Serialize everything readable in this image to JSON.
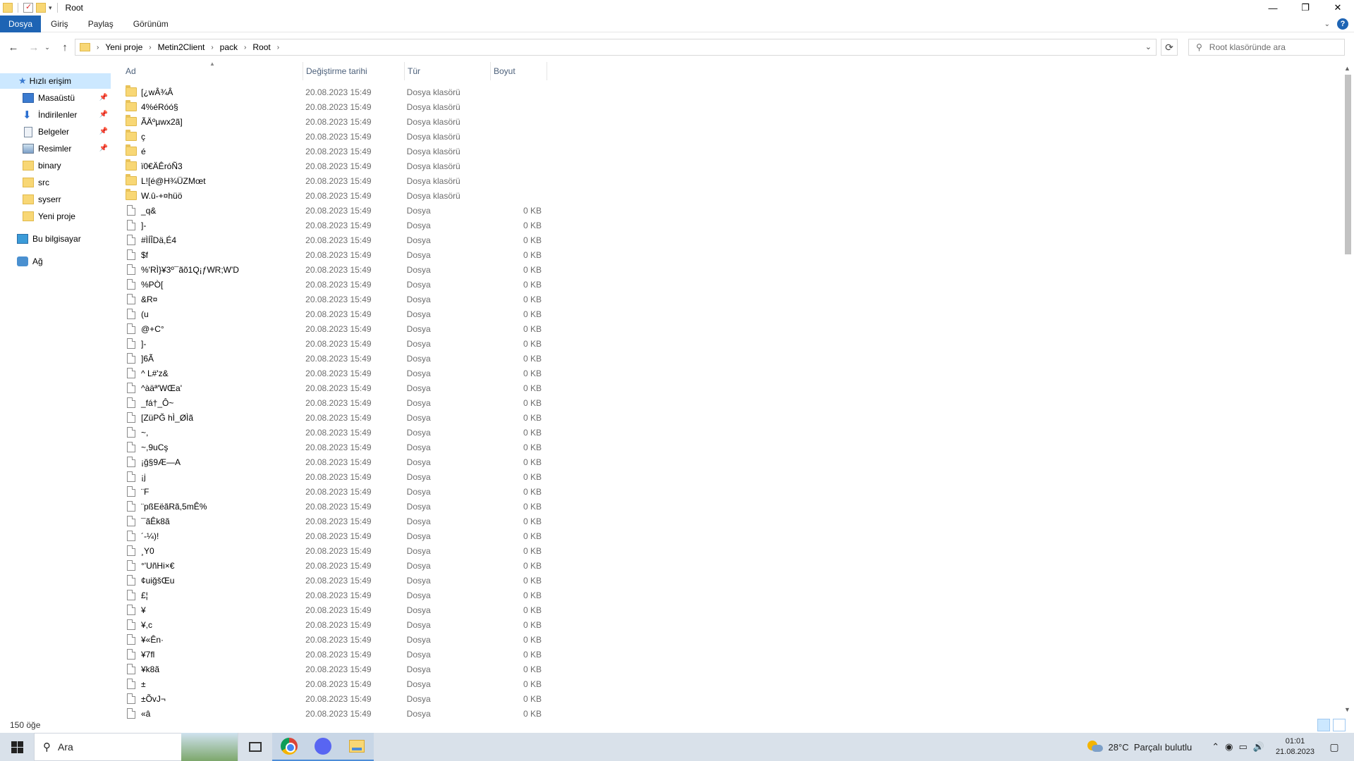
{
  "window": {
    "title": "Root"
  },
  "ribbon": {
    "tabs": [
      "Dosya",
      "Giriş",
      "Paylaş",
      "Görünüm"
    ]
  },
  "address": {
    "crumbs": [
      "Yeni proje",
      "Metin2Client",
      "pack",
      "Root"
    ],
    "search_placeholder": "Root klasöründe ara"
  },
  "sidebar": {
    "items": [
      {
        "label": "Hızlı erişim",
        "icon": "star-icon"
      },
      {
        "label": "Masaüstü",
        "icon": "desktop-icon"
      },
      {
        "label": "İndirilenler",
        "icon": "download-icon"
      },
      {
        "label": "Belgeler",
        "icon": "documents-icon"
      },
      {
        "label": "Resimler",
        "icon": "pictures-icon"
      },
      {
        "label": "binary",
        "icon": "folder-icon"
      },
      {
        "label": "src",
        "icon": "folder-icon"
      },
      {
        "label": "syserr",
        "icon": "folder-icon"
      },
      {
        "label": "Yeni proje",
        "icon": "folder-icon"
      },
      {
        "label": "Bu bilgisayar",
        "icon": "computer-icon"
      },
      {
        "label": "Ağ",
        "icon": "network-icon"
      }
    ]
  },
  "columns": {
    "name": "Ad",
    "date": "Değiştirme tarihi",
    "type": "Tür",
    "size": "Boyut"
  },
  "files": [
    {
      "name": "[¿wÂ¾Â",
      "date": "20.08.2023 15:49",
      "type": "Dosya klasörü",
      "size": "",
      "folder": true
    },
    {
      "name": "4%éRóó§",
      "date": "20.08.2023 15:49",
      "type": "Dosya klasörü",
      "size": "",
      "folder": true
    },
    {
      "name": "ÃÄºµwx2ã]",
      "date": "20.08.2023 15:49",
      "type": "Dosya klasörü",
      "size": "",
      "folder": true
    },
    {
      "name": "ç",
      "date": "20.08.2023 15:49",
      "type": "Dosya klasörü",
      "size": "",
      "folder": true
    },
    {
      "name": "é",
      "date": "20.08.2023 15:49",
      "type": "Dosya klasörü",
      "size": "",
      "folder": true
    },
    {
      "name": "ï0€ÄÊróÑ3",
      "date": "20.08.2023 15:49",
      "type": "Dosya klasörü",
      "size": "",
      "folder": true
    },
    {
      "name": "L![é@H¾ÜZMœt",
      "date": "20.08.2023 15:49",
      "type": "Dosya klasörü",
      "size": "",
      "folder": true
    },
    {
      "name": "W.û-+¤hüö",
      "date": "20.08.2023 15:49",
      "type": "Dosya klasörü",
      "size": "",
      "folder": true
    },
    {
      "name": "_q&",
      "date": "20.08.2023 15:49",
      "type": "Dosya",
      "size": "0 KB",
      "folder": false
    },
    {
      "name": "]-",
      "date": "20.08.2023 15:49",
      "type": "Dosya",
      "size": "0 KB",
      "folder": false
    },
    {
      "name": "#ÌÍÎDä,É4",
      "date": "20.08.2023 15:49",
      "type": "Dosya",
      "size": "0 KB",
      "folder": false
    },
    {
      "name": "$f",
      "date": "20.08.2023 15:49",
      "type": "Dosya",
      "size": "0 KB",
      "folder": false
    },
    {
      "name": "%'RÌ}¥3º¯ãõ1Q¡ƒWR;W'D",
      "date": "20.08.2023 15:49",
      "type": "Dosya",
      "size": "0 KB",
      "folder": false
    },
    {
      "name": "%PÒ[",
      "date": "20.08.2023 15:49",
      "type": "Dosya",
      "size": "0 KB",
      "folder": false
    },
    {
      "name": "&R¤",
      "date": "20.08.2023 15:49",
      "type": "Dosya",
      "size": "0 KB",
      "folder": false
    },
    {
      "name": "(u",
      "date": "20.08.2023 15:49",
      "type": "Dosya",
      "size": "0 KB",
      "folder": false
    },
    {
      "name": "@+C°",
      "date": "20.08.2023 15:49",
      "type": "Dosya",
      "size": "0 KB",
      "folder": false
    },
    {
      "name": "]-",
      "date": "20.08.2023 15:49",
      "type": "Dosya",
      "size": "0 KB",
      "folder": false
    },
    {
      "name": "]6Ã",
      "date": "20.08.2023 15:49",
      "type": "Dosya",
      "size": "0 KB",
      "folder": false
    },
    {
      "name": "^ L#'z&",
      "date": "20.08.2023 15:49",
      "type": "Dosya",
      "size": "0 KB",
      "folder": false
    },
    {
      "name": "^àäª'WŒa'",
      "date": "20.08.2023 15:49",
      "type": "Dosya",
      "size": "0 KB",
      "folder": false
    },
    {
      "name": "_fá†_Ô~",
      "date": "20.08.2023 15:49",
      "type": "Dosya",
      "size": "0 KB",
      "folder": false
    },
    {
      "name": "[ZüPĞ hÌ_ØÌã",
      "date": "20.08.2023 15:49",
      "type": "Dosya",
      "size": "0 KB",
      "folder": false
    },
    {
      "name": "~,",
      "date": "20.08.2023 15:49",
      "type": "Dosya",
      "size": "0 KB",
      "folder": false
    },
    {
      "name": "~,9uCş",
      "date": "20.08.2023 15:49",
      "type": "Dosya",
      "size": "0 KB",
      "folder": false
    },
    {
      "name": "¡ğ§9Æ—A",
      "date": "20.08.2023 15:49",
      "type": "Dosya",
      "size": "0 KB",
      "folder": false
    },
    {
      "name": "¡j",
      "date": "20.08.2023 15:49",
      "type": "Dosya",
      "size": "0 KB",
      "folder": false
    },
    {
      "name": "¨F",
      "date": "20.08.2023 15:49",
      "type": "Dosya",
      "size": "0 KB",
      "folder": false
    },
    {
      "name": "¨pßEëãRã,5mÊ%",
      "date": "20.08.2023 15:49",
      "type": "Dosya",
      "size": "0 KB",
      "folder": false
    },
    {
      "name": "¯ãÊk8ã",
      "date": "20.08.2023 15:49",
      "type": "Dosya",
      "size": "0 KB",
      "folder": false
    },
    {
      "name": "´-¼)!",
      "date": "20.08.2023 15:49",
      "type": "Dosya",
      "size": "0 KB",
      "folder": false
    },
    {
      "name": "¸Y0",
      "date": "20.08.2023 15:49",
      "type": "Dosya",
      "size": "0 KB",
      "folder": false
    },
    {
      "name": "°'UñHi×€",
      "date": "20.08.2023 15:49",
      "type": "Dosya",
      "size": "0 KB",
      "folder": false
    },
    {
      "name": "¢uiğšŒu",
      "date": "20.08.2023 15:49",
      "type": "Dosya",
      "size": "0 KB",
      "folder": false
    },
    {
      "name": "£¦",
      "date": "20.08.2023 15:49",
      "type": "Dosya",
      "size": "0 KB",
      "folder": false
    },
    {
      "name": "¥",
      "date": "20.08.2023 15:49",
      "type": "Dosya",
      "size": "0 KB",
      "folder": false
    },
    {
      "name": "¥,c",
      "date": "20.08.2023 15:49",
      "type": "Dosya",
      "size": "0 KB",
      "folder": false
    },
    {
      "name": "¥«Ên·",
      "date": "20.08.2023 15:49",
      "type": "Dosya",
      "size": "0 KB",
      "folder": false
    },
    {
      "name": "¥7fl",
      "date": "20.08.2023 15:49",
      "type": "Dosya",
      "size": "0 KB",
      "folder": false
    },
    {
      "name": "¥k8ã",
      "date": "20.08.2023 15:49",
      "type": "Dosya",
      "size": "0 KB",
      "folder": false
    },
    {
      "name": "±",
      "date": "20.08.2023 15:49",
      "type": "Dosya",
      "size": "0 KB",
      "folder": false
    },
    {
      "name": "±ÕvJ¬",
      "date": "20.08.2023 15:49",
      "type": "Dosya",
      "size": "0 KB",
      "folder": false
    },
    {
      "name": "«â",
      "date": "20.08.2023 15:49",
      "type": "Dosya",
      "size": "0 KB",
      "folder": false
    }
  ],
  "status": {
    "count": "150 öğe"
  },
  "taskbar": {
    "search_label": "Ara",
    "weather": "28°C  Parçalı bulutlu",
    "time": "01:01",
    "date": "21.08.2023"
  }
}
